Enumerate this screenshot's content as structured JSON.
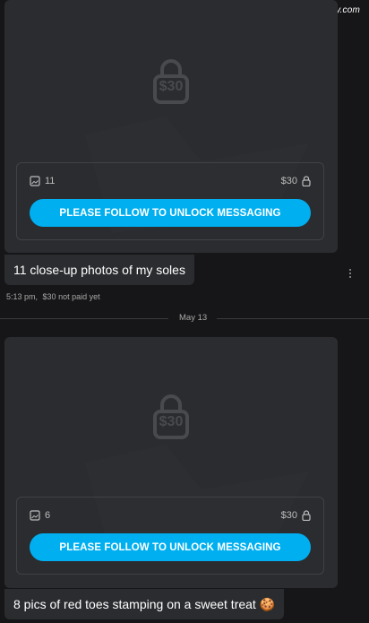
{
  "watermark": "CelebLibrary.com",
  "messages": [
    {
      "price": "$30",
      "media_count": "11",
      "price_label": "$30",
      "unlock_label": "PLEASE FOLLOW TO UNLOCK MESSAGING",
      "caption": "11 close-up photos of my soles"
    },
    {
      "price": "$30",
      "media_count": "6",
      "price_label": "$30",
      "unlock_label": "PLEASE FOLLOW TO UNLOCK MESSAGING",
      "caption": "8 pics of red toes stamping on a sweet treat 🍪"
    }
  ],
  "meta": {
    "time": "5:13 pm,",
    "status": "$30 not paid yet"
  },
  "date_divider": "May 13",
  "icons": {
    "lock": "lock-icon",
    "media": "image-icon",
    "more": "more-vertical-icon"
  },
  "colors": {
    "accent": "#00aff0",
    "card": "#2a2c2f",
    "background": "#161618"
  }
}
